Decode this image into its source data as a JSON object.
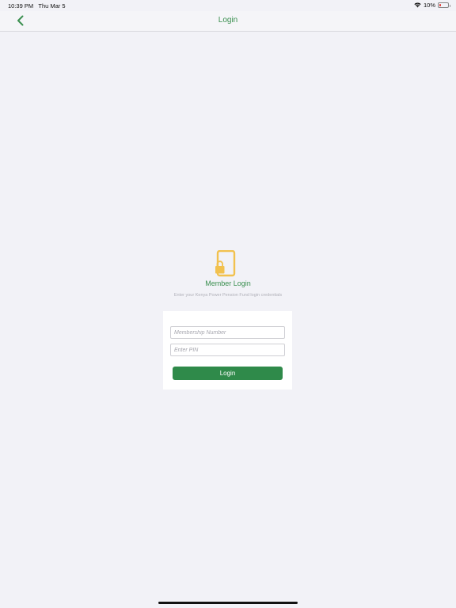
{
  "status_bar": {
    "time": "10:39 PM",
    "date": "Thu Mar 5",
    "battery_percent": "10%",
    "battery_level": 0.1,
    "wifi_icon": "wifi-icon",
    "battery_icon": "battery-icon"
  },
  "nav": {
    "title": "Login",
    "back_icon": "chevron-left-icon"
  },
  "login": {
    "icon": "phone-lock-icon",
    "heading": "Member Login",
    "subtitle": "Enter your Kenya Power Pension Fund login credentials",
    "membership_placeholder": "Membership Number",
    "membership_value": "",
    "pin_placeholder": "Enter PIN",
    "pin_value": "",
    "button_label": "Login"
  },
  "colors": {
    "accent": "#3a8f4f",
    "button": "#2f8a4a",
    "icon": "#f2c14e",
    "background": "#f2f2f7"
  }
}
